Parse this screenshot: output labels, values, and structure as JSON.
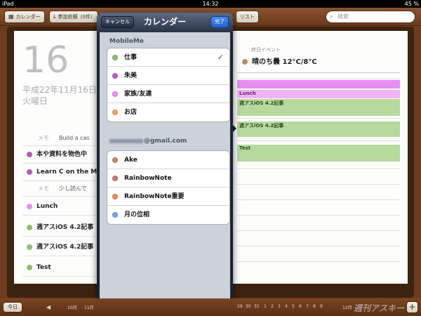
{
  "status_bar": {
    "device": "iPad",
    "time": "14:32",
    "battery": "45 %"
  },
  "toolbar": {
    "calendars_label": "カレンダー",
    "invitations_label": "参加依頼（0件）",
    "list_label": "リスト",
    "search_placeholder": "検索"
  },
  "day_view": {
    "day_number": "16",
    "date_text": "平成22年11月16日",
    "weekday": "火曜日",
    "items": [
      {
        "kind": "memo",
        "label": "メモ",
        "text": "Build a cas"
      },
      {
        "kind": "event",
        "title": "本や資料を物色中",
        "color": "#b55cbd"
      },
      {
        "kind": "event",
        "title": "Learn C on the Mac",
        "color": "#b55cbd"
      },
      {
        "kind": "memo",
        "label": "メモ",
        "text": "少し読んで"
      },
      {
        "kind": "event",
        "title": "Lunch",
        "color": "#e58ef0"
      },
      {
        "kind": "event",
        "title": "週アスiOS 4.2記事",
        "color": "#8ebf6e"
      },
      {
        "kind": "event",
        "title": "週アスiOS 4.2記事",
        "color": "#8ebf6e"
      },
      {
        "kind": "event",
        "title": "Test",
        "color": "#8ebf6e"
      }
    ]
  },
  "timeline": {
    "allday_label": "終日イベント",
    "weather": "晴のち曇 12°C/8°C",
    "events": [
      {
        "title": "",
        "color": "#e58ef0"
      },
      {
        "title": "Lunch",
        "color": "#f1b2f6"
      },
      {
        "title": "週アスiOS 4.2記事",
        "color": "#b6d99e"
      },
      {
        "title": "週アスiOS 4.2記事",
        "color": "#b6d99e"
      },
      {
        "title": "Test",
        "color": "#b6d99e"
      }
    ]
  },
  "popover": {
    "title": "カレンダー",
    "cancel_label": "キャンセル",
    "done_label": "完了",
    "sections": [
      {
        "header": "MobileMe",
        "calendars": [
          {
            "name": "仕事",
            "color": "#8ebf6e",
            "checked": true
          },
          {
            "name": "朱美",
            "color": "#c35fc4",
            "checked": false
          },
          {
            "name": "家族/友達",
            "color": "#ef8ef7",
            "checked": false
          },
          {
            "name": "お店",
            "color": "#f2a264",
            "checked": false
          }
        ]
      },
      {
        "header": "@gmail.com",
        "calendars": [
          {
            "name": "Ake",
            "color": "#b68f6a",
            "checked": false
          },
          {
            "name": "RainbowNote",
            "color": "#c47a7a",
            "checked": false
          },
          {
            "name": "RainbowNote重要",
            "color": "#ef8c5a",
            "checked": false
          },
          {
            "name": "月の位相",
            "color": "#7aa0dd",
            "checked": false
          }
        ]
      }
    ]
  },
  "bottom_bar": {
    "today_label": "今日",
    "months_left": [
      "10月",
      "11月"
    ],
    "months_right": [
      "29",
      "30",
      "31",
      "1",
      "2",
      "3",
      "4",
      "5",
      "6",
      "7",
      "8",
      "9",
      "12月"
    ],
    "add_label": "+",
    "watermark": "週刊アスキー"
  }
}
